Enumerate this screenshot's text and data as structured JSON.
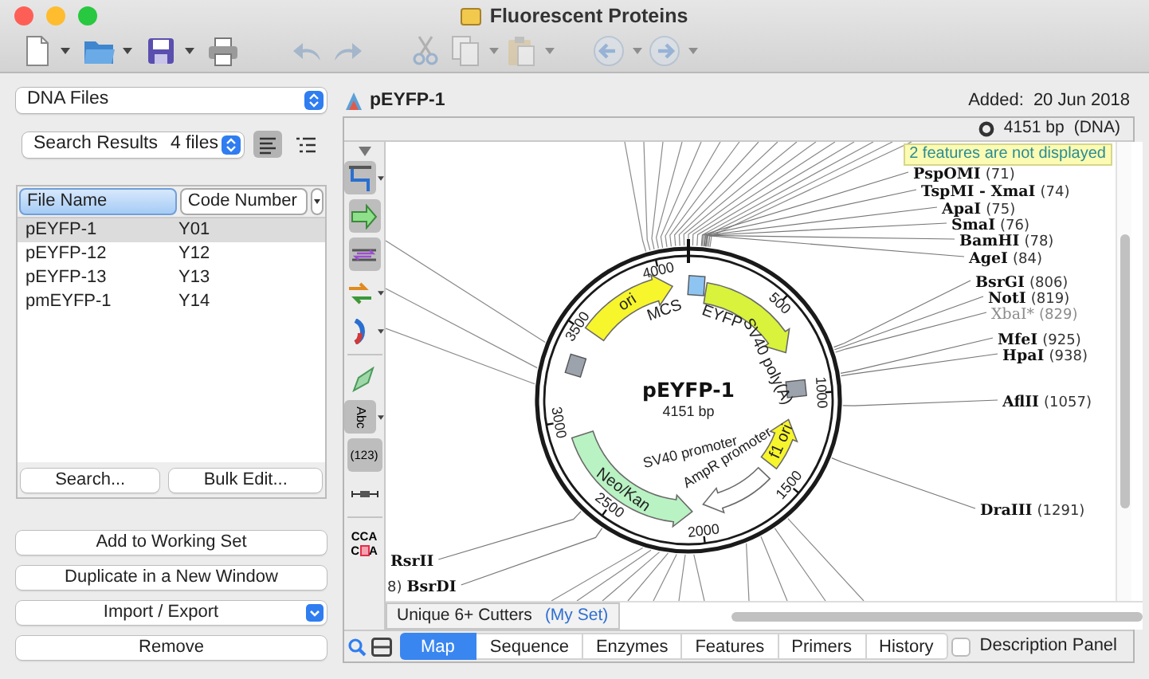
{
  "window": {
    "title": "Fluorescent Proteins"
  },
  "toolbar": [
    {
      "kind": "new",
      "dropdown": true,
      "disabled": false
    },
    {
      "kind": "open",
      "dropdown": true,
      "disabled": false
    },
    {
      "kind": "save",
      "dropdown": true,
      "disabled": false
    },
    {
      "kind": "print",
      "dropdown": false,
      "disabled": false
    },
    {
      "kind": "undo",
      "dropdown": false,
      "disabled": true
    },
    {
      "kind": "redo",
      "dropdown": false,
      "disabled": true
    },
    {
      "kind": "cut",
      "dropdown": false,
      "disabled": true
    },
    {
      "kind": "copy",
      "dropdown": true,
      "disabled": true
    },
    {
      "kind": "paste",
      "dropdown": true,
      "disabled": true
    },
    {
      "kind": "back",
      "dropdown": true,
      "disabled": true
    },
    {
      "kind": "forward",
      "dropdown": true,
      "disabled": true
    }
  ],
  "sidebar": {
    "collection": "DNA Files",
    "search_scope": "Search Results",
    "file_count": "4 files",
    "view_modes": [
      {
        "kind": "list",
        "selected": true
      },
      {
        "kind": "outline",
        "selected": false
      }
    ],
    "columns": [
      {
        "label": "File Name",
        "selected": true
      },
      {
        "label": "Code Number",
        "selected": false
      }
    ],
    "rows": [
      {
        "file_name": "pEYFP-1",
        "code_number": "Y01",
        "selected": true
      },
      {
        "file_name": "pEYFP-12",
        "code_number": "Y12",
        "selected": false
      },
      {
        "file_name": "pEYFP-13",
        "code_number": "Y13",
        "selected": false
      },
      {
        "file_name": "pmEYFP-1",
        "code_number": "Y14",
        "selected": false
      }
    ],
    "table_buttons": [
      "Search...",
      "Bulk Edit..."
    ],
    "actions": [
      {
        "label": "Add to Working Set",
        "kind": "button"
      },
      {
        "label": "Duplicate in a New Window",
        "kind": "button"
      },
      {
        "label": "Import / Export",
        "kind": "menu"
      },
      {
        "label": "Remove",
        "kind": "button"
      }
    ]
  },
  "document": {
    "title": "pEYFP-1",
    "added_label": "Added:",
    "added_date": "20 Jun 2018",
    "sequence_length": "4151 bp",
    "sequence_type": "(DNA)",
    "notice": "2 features are not displayed",
    "palette": [
      {
        "kind": "enzymes",
        "dropdown": true
      },
      {
        "kind": "feature"
      },
      {
        "kind": "strands"
      },
      {
        "kind": "primers",
        "dropdown": true
      },
      {
        "kind": "orientation",
        "dropdown": true
      },
      {
        "kind": "pen"
      },
      {
        "kind": "text",
        "label": "Abc",
        "dropdown": true
      },
      {
        "kind": "numbers",
        "label": "(123)"
      },
      {
        "kind": "ruler"
      },
      {
        "kind": "translation",
        "label": "CCA",
        "label_2": "C",
        "label_3": "A"
      }
    ],
    "map": {
      "name": "pEYFP-1",
      "length": "4151 bp",
      "ticks": [
        "500",
        "1000",
        "1500",
        "2000",
        "2500",
        "3000",
        "3500",
        "4000"
      ],
      "features": [
        {
          "label": "MCS",
          "kind": "box",
          "color": "#8ec4f2"
        },
        {
          "label": "EYFP",
          "kind": "arrow",
          "color": "#d9f23c"
        },
        {
          "label": "SV40 poly(A)",
          "kind": "box",
          "color": "#9ca3ad"
        },
        {
          "label": "f1 ori",
          "kind": "arrow",
          "color": "#f7f52c"
        },
        {
          "label": "AmpR promoter",
          "kind": "arrow",
          "color": "#ffffff"
        },
        {
          "label": "SV40 promoter",
          "kind": "label"
        },
        {
          "label": "Neo/Kan",
          "kind": "arrow",
          "color": "#b9f2c3"
        },
        {
          "label": "ori",
          "kind": "arrow",
          "color": "#f7f52c"
        },
        {
          "kind": "box",
          "color": "#9ca3ad"
        }
      ],
      "enzymes": [
        {
          "name": "PspOMI",
          "position": "(71)",
          "dimmed": false
        },
        {
          "name": "TspMI - XmaI",
          "position": "(74)",
          "dimmed": false
        },
        {
          "name": "ApaI",
          "position": "(75)",
          "dimmed": false
        },
        {
          "name": "SmaI",
          "position": "(76)",
          "dimmed": false
        },
        {
          "name": "BamHI",
          "position": "(78)",
          "dimmed": false
        },
        {
          "name": "AgeI",
          "position": "(84)",
          "dimmed": false
        },
        {
          "name": "BsrGI",
          "position": "(806)",
          "dimmed": false
        },
        {
          "name": "NotI",
          "position": "(819)",
          "dimmed": false
        },
        {
          "name": "XbaI*",
          "position": "(829)",
          "dimmed": true
        },
        {
          "name": "MfeI",
          "position": "(925)",
          "dimmed": false
        },
        {
          "name": "HpaI",
          "position": "(938)",
          "dimmed": false
        },
        {
          "name": "AflII",
          "position": "(1057)",
          "dimmed": false
        },
        {
          "name": "DraIII",
          "position": "(1291)",
          "dimmed": false
        },
        {
          "name": "RsrII",
          "dimmed": false
        },
        {
          "name": "BsrDI",
          "position": "8)",
          "dimmed": false
        }
      ]
    },
    "enzyme_set": "Unique 6+ Cutters",
    "enzyme_set_name": "(My Set)",
    "tabs": [
      {
        "label": "Map",
        "selected": true
      },
      {
        "label": "Sequence",
        "selected": false
      },
      {
        "label": "Enzymes",
        "selected": false
      },
      {
        "label": "Features",
        "selected": false
      },
      {
        "label": "Primers",
        "selected": false
      },
      {
        "label": "History",
        "selected": false
      }
    ],
    "description_panel": {
      "label": "Description Panel",
      "checked": false
    }
  }
}
